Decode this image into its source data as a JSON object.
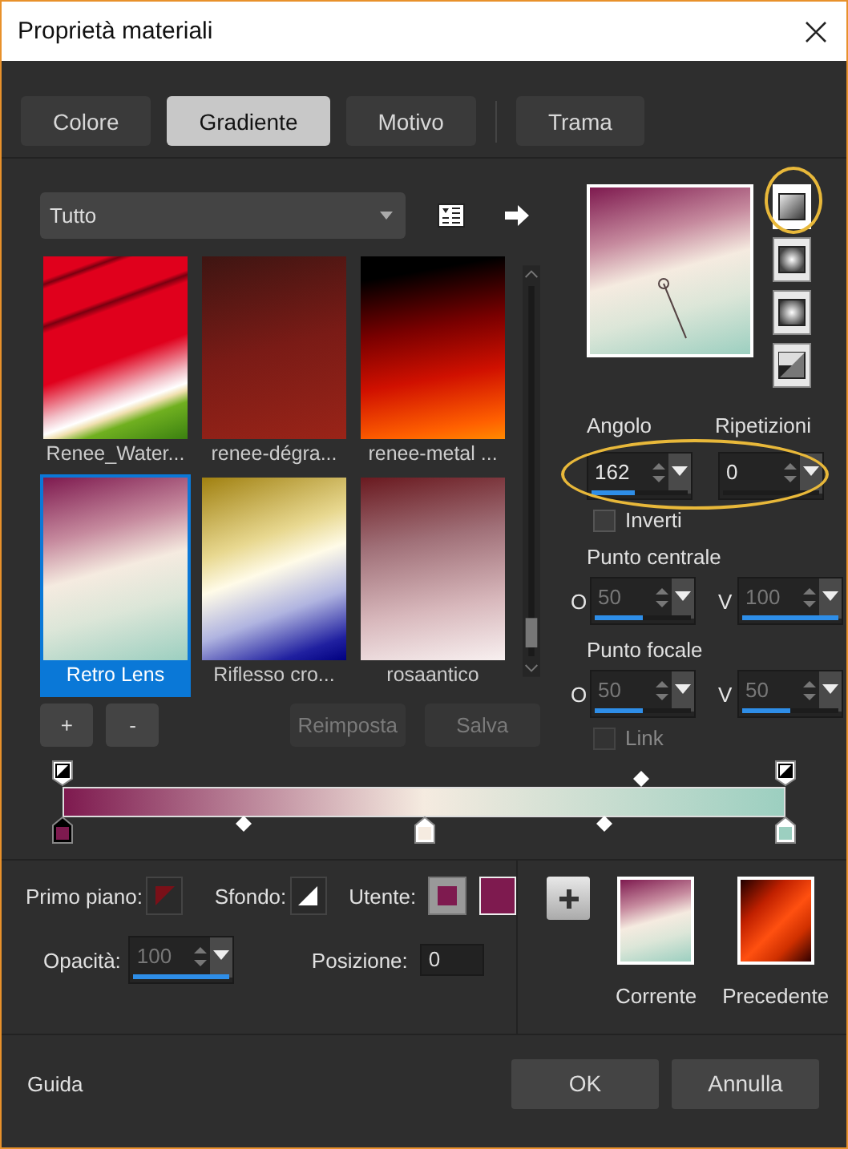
{
  "window": {
    "title": "Proprietà materiali"
  },
  "tabs": [
    {
      "label": "Colore",
      "selected": false
    },
    {
      "label": "Gradiente",
      "selected": true
    },
    {
      "label": "Motivo",
      "selected": false
    },
    {
      "label": "Trama",
      "selected": false
    }
  ],
  "gradients": {
    "filter": "Tutto",
    "items": [
      {
        "name": "Renee_Water...",
        "selected": false
      },
      {
        "name": "renee-dégra...",
        "selected": false
      },
      {
        "name": "renee-metal ...",
        "selected": false
      },
      {
        "name": "Retro Lens",
        "selected": true
      },
      {
        "name": "Riflesso cro...",
        "selected": false
      },
      {
        "name": "rosaantico",
        "selected": false
      }
    ]
  },
  "styles": [
    {
      "kind": "linear",
      "selected": true
    },
    {
      "kind": "rectangular",
      "selected": false
    },
    {
      "kind": "sunburst",
      "selected": false
    },
    {
      "kind": "radial",
      "selected": false
    }
  ],
  "angle": {
    "label": "Angolo",
    "value": "162",
    "level": 0.45
  },
  "repeats": {
    "label": "Ripetizioni",
    "value": "0",
    "level": 0
  },
  "invert": {
    "label": "Inverti",
    "checked": false,
    "disabled": false
  },
  "center_point": {
    "label": "Punto centrale",
    "fields": [
      {
        "axis": "O",
        "value": "50",
        "level": 0.5,
        "disabled": true
      },
      {
        "axis": "V",
        "value": "100",
        "level": 1,
        "disabled": true
      }
    ]
  },
  "focal_point": {
    "label": "Punto focale",
    "fields": [
      {
        "axis": "O",
        "value": "50",
        "level": 0.5,
        "disabled": true
      },
      {
        "axis": "V",
        "value": "50",
        "level": 0.5,
        "disabled": true
      }
    ]
  },
  "link": {
    "label": "Link",
    "checked": false,
    "disabled": true
  },
  "list_buttons": [
    {
      "label": "+",
      "disabled": false
    },
    {
      "label": "-",
      "disabled": false
    }
  ],
  "action_buttons": [
    {
      "label": "Reimposta",
      "disabled": true
    },
    {
      "label": "Salva",
      "disabled": true
    }
  ],
  "gradient_bar": {
    "opacity_stops": [
      {
        "level": 0,
        "selected": false
      },
      {
        "level": 1,
        "selected": false
      }
    ],
    "opacity_midpoints": [
      {
        "level": 0.8
      }
    ],
    "color_stops": [
      {
        "level": 0,
        "color": "#7e1a4f",
        "selected": true
      },
      {
        "level": 0.5,
        "color": "#f5ebe0",
        "selected": false
      },
      {
        "level": 1,
        "color": "#9ccfc0",
        "selected": false
      }
    ],
    "color_midpoints": [
      {
        "level": 0.25
      },
      {
        "level": 0.75
      }
    ]
  },
  "materials": {
    "foreground": "Primo piano:",
    "background": "Sfondo:",
    "user": "Utente:"
  },
  "opacity": {
    "label": "Opacità:",
    "value": "100",
    "level": 1,
    "disabled": true
  },
  "position": {
    "label": "Posizione:",
    "value": "0"
  },
  "previews": [
    {
      "label": "Corrente"
    },
    {
      "label": "Precedente"
    }
  ],
  "footer": {
    "help": "Guida",
    "buttons": [
      {
        "label": "OK"
      },
      {
        "label": "Annulla"
      }
    ]
  }
}
